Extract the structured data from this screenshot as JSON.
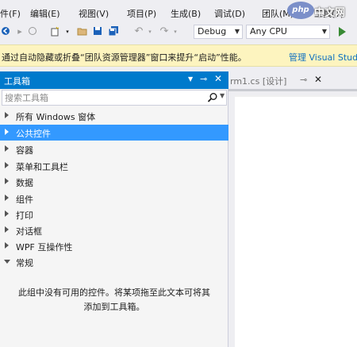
{
  "menu": {
    "items": [
      "件(F)",
      "编辑(E)",
      "视图(V)",
      "项目(P)",
      "生成(B)",
      "调试(D)",
      "团队(M)",
      "工具(T)"
    ]
  },
  "logo": {
    "php": "php",
    "site": "中文网"
  },
  "toolbar": {
    "config": "Debug",
    "platform": "Any CPU"
  },
  "infobar": {
    "message": "通过自动隐藏或折叠“团队资源管理器”窗口来提升“启动”性能。",
    "link": "管理 Visual Studio"
  },
  "toolbox": {
    "title": "工具箱",
    "search_placeholder": "搜索工具箱",
    "groups": [
      {
        "label": "所有 Windows 窗体"
      },
      {
        "label": "公共控件"
      },
      {
        "label": "容器"
      },
      {
        "label": "菜单和工具栏"
      },
      {
        "label": "数据"
      },
      {
        "label": "组件"
      },
      {
        "label": "打印"
      },
      {
        "label": "对话框"
      },
      {
        "label": "WPF 互操作性"
      },
      {
        "label": "常规"
      }
    ],
    "selected_group": "公共控件",
    "expanded_group": "常规",
    "empty_text_line1": "此组中没有可用的控件。将某项拖至此文本可将其",
    "empty_text_line2": "添加到工具箱。"
  },
  "document": {
    "tab_label": "rm1.cs [设计]"
  },
  "colors": {
    "accent": "#007acc",
    "selection": "#3399ff",
    "infobar": "#fdf4bf",
    "link": "#0e70c0"
  },
  "icons": [
    "back-icon",
    "forward-icon",
    "new-project-icon",
    "open-file-icon",
    "save-icon",
    "save-all-icon",
    "undo-icon",
    "redo-icon",
    "start-debug-icon",
    "search-icon",
    "pin-icon",
    "close-icon",
    "dropdown-icon"
  ]
}
